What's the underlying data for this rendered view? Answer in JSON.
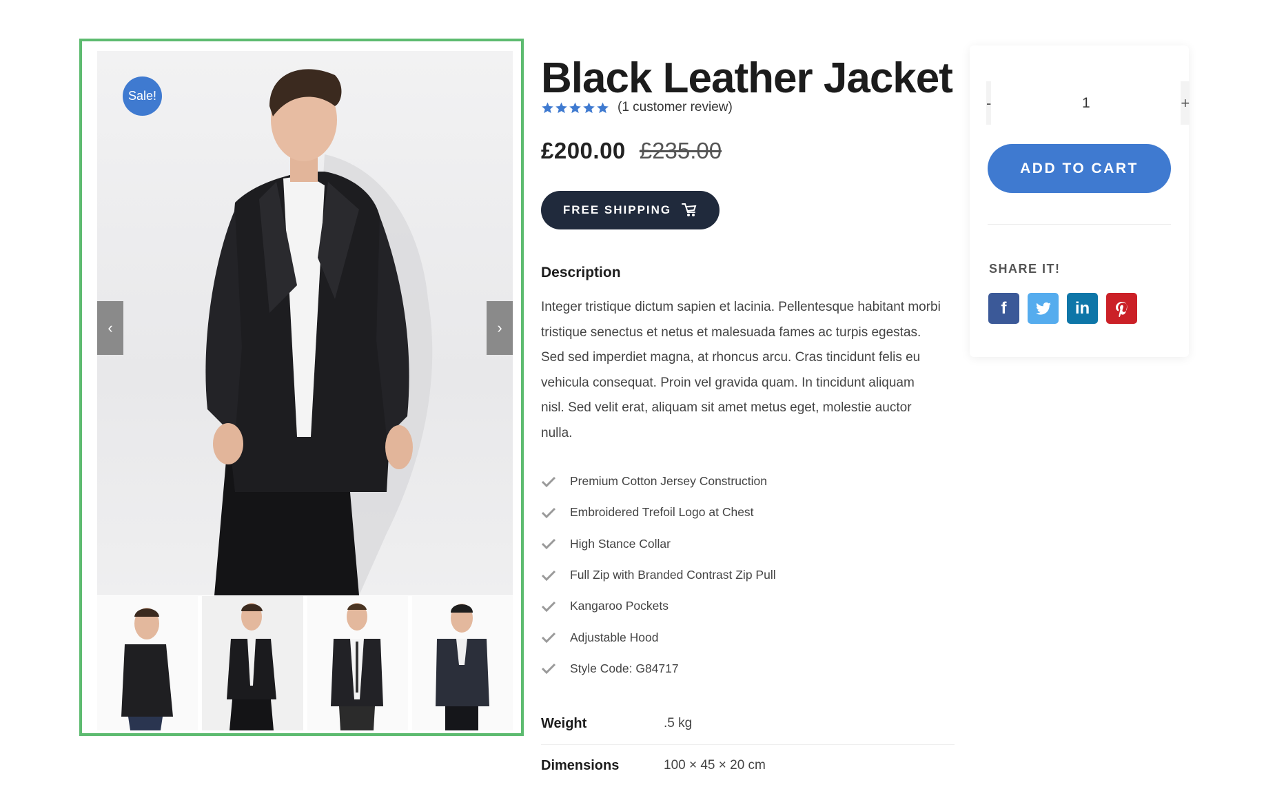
{
  "gallery": {
    "sale_badge": "Sale!",
    "prev_arrow": "‹",
    "next_arrow": "›",
    "thumbnail_count": 4
  },
  "product": {
    "title": "Black Leather Jacket",
    "rating": 5,
    "review_text": "(1 customer review)",
    "price_current": "£200.00",
    "price_original": "£235.00",
    "shipping_label": "FREE SHIPPING",
    "description_heading": "Description",
    "description": "Integer tristique dictum sapien et lacinia. Pellentesque habitant morbi tristique senectus et netus et malesuada fames ac turpis egestas. Sed sed imperdiet magna, at rhoncus arcu. Cras tincidunt felis eu vehicula consequat. Proin vel gravida quam. In tincidunt aliquam nisl. Sed velit erat, aliquam sit amet metus eget, molestie auctor nulla.",
    "features": [
      "Premium Cotton Jersey Construction",
      "Embroidered Trefoil Logo at Chest",
      "High Stance Collar",
      "Full Zip with Branded Contrast Zip Pull",
      "Kangaroo Pockets",
      "Adjustable Hood",
      "Style Code: G84717"
    ],
    "attributes": [
      {
        "label": "Weight",
        "value": ".5 kg"
      },
      {
        "label": "Dimensions",
        "value": "100 × 45 × 20 cm"
      }
    ]
  },
  "cart": {
    "minus": "-",
    "quantity": "1",
    "plus": "+",
    "add_to_cart": "ADD TO CART",
    "share_label": "SHARE IT!",
    "social": [
      {
        "name": "facebook",
        "glyph": "f",
        "color": "#3b5998"
      },
      {
        "name": "twitter",
        "glyph": "",
        "color": "#55acee"
      },
      {
        "name": "linkedin",
        "glyph": "in",
        "color": "#0e76a8"
      },
      {
        "name": "pinterest",
        "glyph": "",
        "color": "#cb2027"
      }
    ]
  },
  "colors": {
    "accent": "#3f7ad0",
    "dark_button": "#202a3c",
    "gallery_border": "#5dbb70"
  }
}
